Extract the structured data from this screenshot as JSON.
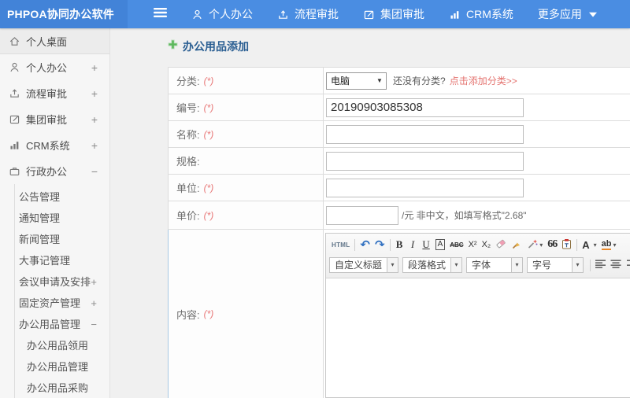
{
  "app": {
    "title": "PHPOA协同办公软件"
  },
  "navbar": {
    "items": [
      {
        "label": "个人办公",
        "icon": "user-icon"
      },
      {
        "label": "流程审批",
        "icon": "share-icon"
      },
      {
        "label": "集团审批",
        "icon": "edit-icon"
      },
      {
        "label": "CRM系统",
        "icon": "chart-icon"
      },
      {
        "label": "更多应用",
        "icon": "caret-down-icon"
      }
    ]
  },
  "sidebar": {
    "items": [
      {
        "label": "个人桌面",
        "expand": "",
        "icon": "home-icon"
      },
      {
        "label": "个人办公",
        "expand": "+",
        "icon": "user-icon"
      },
      {
        "label": "流程审批",
        "expand": "+",
        "icon": "share-icon"
      },
      {
        "label": "集团审批",
        "expand": "+",
        "icon": "edit-icon"
      },
      {
        "label": "CRM系统",
        "expand": "+",
        "icon": "chart-icon"
      },
      {
        "label": "行政办公",
        "expand": "−",
        "icon": "briefcase-icon"
      }
    ],
    "admin_children": [
      {
        "label": "公告管理",
        "expand": ""
      },
      {
        "label": "通知管理",
        "expand": ""
      },
      {
        "label": "新闻管理",
        "expand": ""
      },
      {
        "label": "大事记管理",
        "expand": ""
      },
      {
        "label": "会议申请及安排",
        "expand": "+"
      },
      {
        "label": "固定资产管理",
        "expand": "+"
      },
      {
        "label": "办公用品管理",
        "expand": "−"
      }
    ],
    "supplies_children": [
      {
        "label": "办公用品领用"
      },
      {
        "label": "办公用品管理"
      },
      {
        "label": "办公用品采购"
      }
    ]
  },
  "main": {
    "title": "办公用品添加",
    "form": {
      "category": {
        "label": "分类:",
        "required": "(*)",
        "value": "电脑",
        "hint": "还没有分类?",
        "link": "点击添加分类>>"
      },
      "code": {
        "label": "编号:",
        "required": "(*)",
        "value": "20190903085308"
      },
      "name": {
        "label": "名称:",
        "required": "(*)",
        "value": ""
      },
      "spec": {
        "label": "规格:",
        "value": ""
      },
      "unit": {
        "label": "单位:",
        "required": "(*)",
        "value": ""
      },
      "price": {
        "label": "单价:",
        "required": "(*)",
        "value": "",
        "suffix": "/元 非中文，如填写格式\"2.68\""
      },
      "content": {
        "label": "内容:",
        "required": "(*)"
      }
    },
    "editor": {
      "html_btn": "HTML",
      "bold": "B",
      "italic": "I",
      "underline": "U",
      "char_border": "A",
      "strike": "ABC",
      "superscript": "X²",
      "subscript": "X₂",
      "blockquote": "66",
      "font_color": "A",
      "highlight": "ab",
      "combos": [
        {
          "label": "自定义标题"
        },
        {
          "label": "段落格式"
        },
        {
          "label": "字体"
        },
        {
          "label": "字号"
        }
      ]
    }
  },
  "colors": {
    "navbar": "#4a8de2",
    "logo_bg": "#4283d8",
    "page_title": "#2a5e92",
    "required": "#e87878",
    "category_link": "#e4736f",
    "content_row_border": "#a9c9e2"
  }
}
